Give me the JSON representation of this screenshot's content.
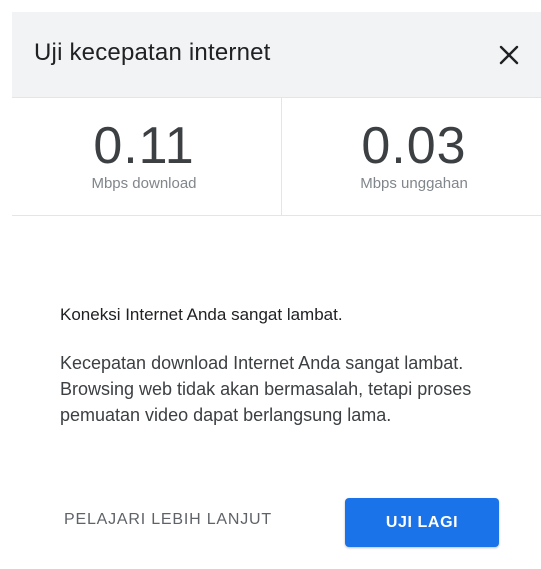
{
  "dialog": {
    "title": "Uji kecepatan internet",
    "close_icon": "close-icon"
  },
  "download": {
    "value": "0.11",
    "unit": "Mbps download"
  },
  "upload": {
    "value": "0.03",
    "unit": "Mbps unggahan"
  },
  "message": {
    "title": "Koneksi Internet Anda sangat lambat.",
    "body": "Kecepatan download Internet Anda sangat lambat. Browsing web tidak akan bermasalah, tetapi proses pemuatan video dapat berlangsung lama."
  },
  "actions": {
    "learn_more": "PELAJARI LEBIH LANJUT",
    "retry": "UJI LAGI"
  },
  "colors": {
    "header_bg": "#f1f3f4",
    "accent": "#1a73e8",
    "value_text": "#3c4043",
    "muted_text": "#80868b"
  }
}
